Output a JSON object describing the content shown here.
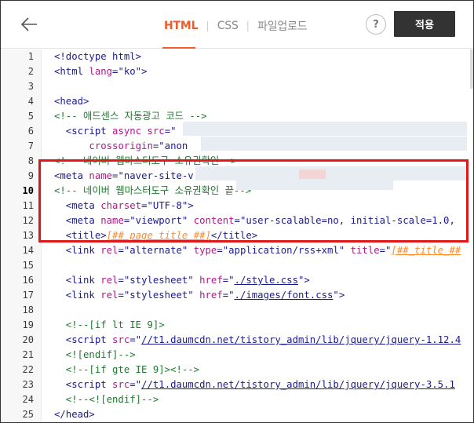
{
  "header": {
    "tabs": [
      {
        "label": "HTML",
        "active": true
      },
      {
        "label": "CSS",
        "active": false
      },
      {
        "label": "파일업로드",
        "active": false
      }
    ],
    "help_label": "?",
    "apply_label": "적용"
  },
  "editor": {
    "current_line": 10,
    "lines": [
      {
        "n": "1",
        "tokens": [
          [
            "tag",
            "<!doctype html>"
          ]
        ]
      },
      {
        "n": "2",
        "tokens": [
          [
            "tag",
            "<html "
          ],
          [
            "attr",
            "lang"
          ],
          [
            "tag",
            "="
          ],
          [
            "str",
            "\"ko\""
          ],
          [
            "tag",
            ">"
          ]
        ]
      },
      {
        "n": "3",
        "tokens": []
      },
      {
        "n": "4",
        "tokens": [
          [
            "tag",
            "<head>"
          ]
        ]
      },
      {
        "n": "5",
        "tokens": [
          [
            "cm",
            "<!-- 애드센스 자동광고 코드 -->"
          ]
        ]
      },
      {
        "n": "6",
        "tokens": [
          [
            "tag",
            "  <script "
          ],
          [
            "attr",
            "async src"
          ],
          [
            "tag",
            "="
          ],
          [
            "str",
            "\""
          ]
        ]
      },
      {
        "n": "7",
        "tokens": [
          [
            "txt",
            "      "
          ],
          [
            "attr",
            "crossorigin"
          ],
          [
            "tag",
            "="
          ],
          [
            "str",
            "\"anon"
          ]
        ]
      },
      {
        "n": "8",
        "tokens": [
          [
            "cm",
            "<!-- 네이버 웹마스터도구 소유권확인-->"
          ]
        ]
      },
      {
        "n": "9",
        "tokens": [
          [
            "tag",
            "<meta "
          ],
          [
            "attr",
            "name"
          ],
          [
            "tag",
            "="
          ],
          [
            "str",
            "\"naver-site-v"
          ]
        ]
      },
      {
        "n": "10",
        "tokens": [
          [
            "cm",
            "<!-- 네이버 웹마스터도구 소유권확인 끝-->"
          ]
        ]
      },
      {
        "n": "11",
        "tokens": [
          [
            "tag",
            "  <meta "
          ],
          [
            "attr",
            "charset"
          ],
          [
            "tag",
            "="
          ],
          [
            "str",
            "\"UTF-8\""
          ],
          [
            "tag",
            ">"
          ]
        ]
      },
      {
        "n": "12",
        "tokens": [
          [
            "tag",
            "  <meta "
          ],
          [
            "attr",
            "name"
          ],
          [
            "tag",
            "="
          ],
          [
            "str",
            "\"viewport\" "
          ],
          [
            "attr",
            "content"
          ],
          [
            "tag",
            "="
          ],
          [
            "str",
            "\"user-scalable=no, initial-scale=1.0,"
          ]
        ]
      },
      {
        "n": "13",
        "tokens": [
          [
            "tag",
            "  <title>"
          ],
          [
            "tpl",
            "[##_page_title_##]"
          ],
          [
            "tag",
            "</title>"
          ]
        ]
      },
      {
        "n": "14",
        "tokens": [
          [
            "tag",
            "  <link "
          ],
          [
            "attr",
            "rel"
          ],
          [
            "tag",
            "="
          ],
          [
            "str",
            "\"alternate\" "
          ],
          [
            "attr",
            "type"
          ],
          [
            "tag",
            "="
          ],
          [
            "str",
            "\"application/rss+xml\" "
          ],
          [
            "attr",
            "title"
          ],
          [
            "tag",
            "="
          ],
          [
            "str",
            "\""
          ],
          [
            "tpl",
            "[##_title_##"
          ]
        ]
      },
      {
        "n": "15",
        "tokens": []
      },
      {
        "n": "16",
        "tokens": [
          [
            "tag",
            "  <link "
          ],
          [
            "attr",
            "rel"
          ],
          [
            "tag",
            "="
          ],
          [
            "str",
            "\"stylesheet\" "
          ],
          [
            "attr",
            "href"
          ],
          [
            "tag",
            "="
          ],
          [
            "str",
            "\""
          ],
          [
            "url",
            "./style.css"
          ],
          [
            "str",
            "\""
          ],
          [
            "tag",
            ">"
          ]
        ]
      },
      {
        "n": "17",
        "tokens": [
          [
            "tag",
            "  <link "
          ],
          [
            "attr",
            "rel"
          ],
          [
            "tag",
            "="
          ],
          [
            "str",
            "\"stylesheet\" "
          ],
          [
            "attr",
            "href"
          ],
          [
            "tag",
            "="
          ],
          [
            "str",
            "\""
          ],
          [
            "url",
            "./images/font.css"
          ],
          [
            "str",
            "\""
          ],
          [
            "tag",
            ">"
          ]
        ]
      },
      {
        "n": "18",
        "tokens": []
      },
      {
        "n": "19",
        "tokens": [
          [
            "cm",
            "  <!--[if lt IE 9]>"
          ]
        ]
      },
      {
        "n": "20",
        "tokens": [
          [
            "tag",
            "  <script "
          ],
          [
            "attr",
            "src"
          ],
          [
            "tag",
            "="
          ],
          [
            "str",
            "\""
          ],
          [
            "url",
            "//t1.daumcdn.net/tistory_admin/lib/jquery/jquery-1.12.4"
          ]
        ]
      },
      {
        "n": "21",
        "tokens": [
          [
            "cm",
            "  <![endif]-->"
          ]
        ]
      },
      {
        "n": "22",
        "tokens": [
          [
            "cm",
            "  <!--[if gte IE 9]><!-->"
          ]
        ]
      },
      {
        "n": "23",
        "tokens": [
          [
            "tag",
            "  <script "
          ],
          [
            "attr",
            "src"
          ],
          [
            "tag",
            "="
          ],
          [
            "str",
            "\""
          ],
          [
            "url",
            "//t1.daumcdn.net/tistory_admin/lib/jquery/jquery-3.5.1"
          ]
        ]
      },
      {
        "n": "24",
        "tokens": [
          [
            "cm",
            "  <!--<![endif]-->"
          ]
        ]
      },
      {
        "n": "25",
        "tokens": [
          [
            "tag",
            "</head>"
          ]
        ]
      }
    ]
  }
}
